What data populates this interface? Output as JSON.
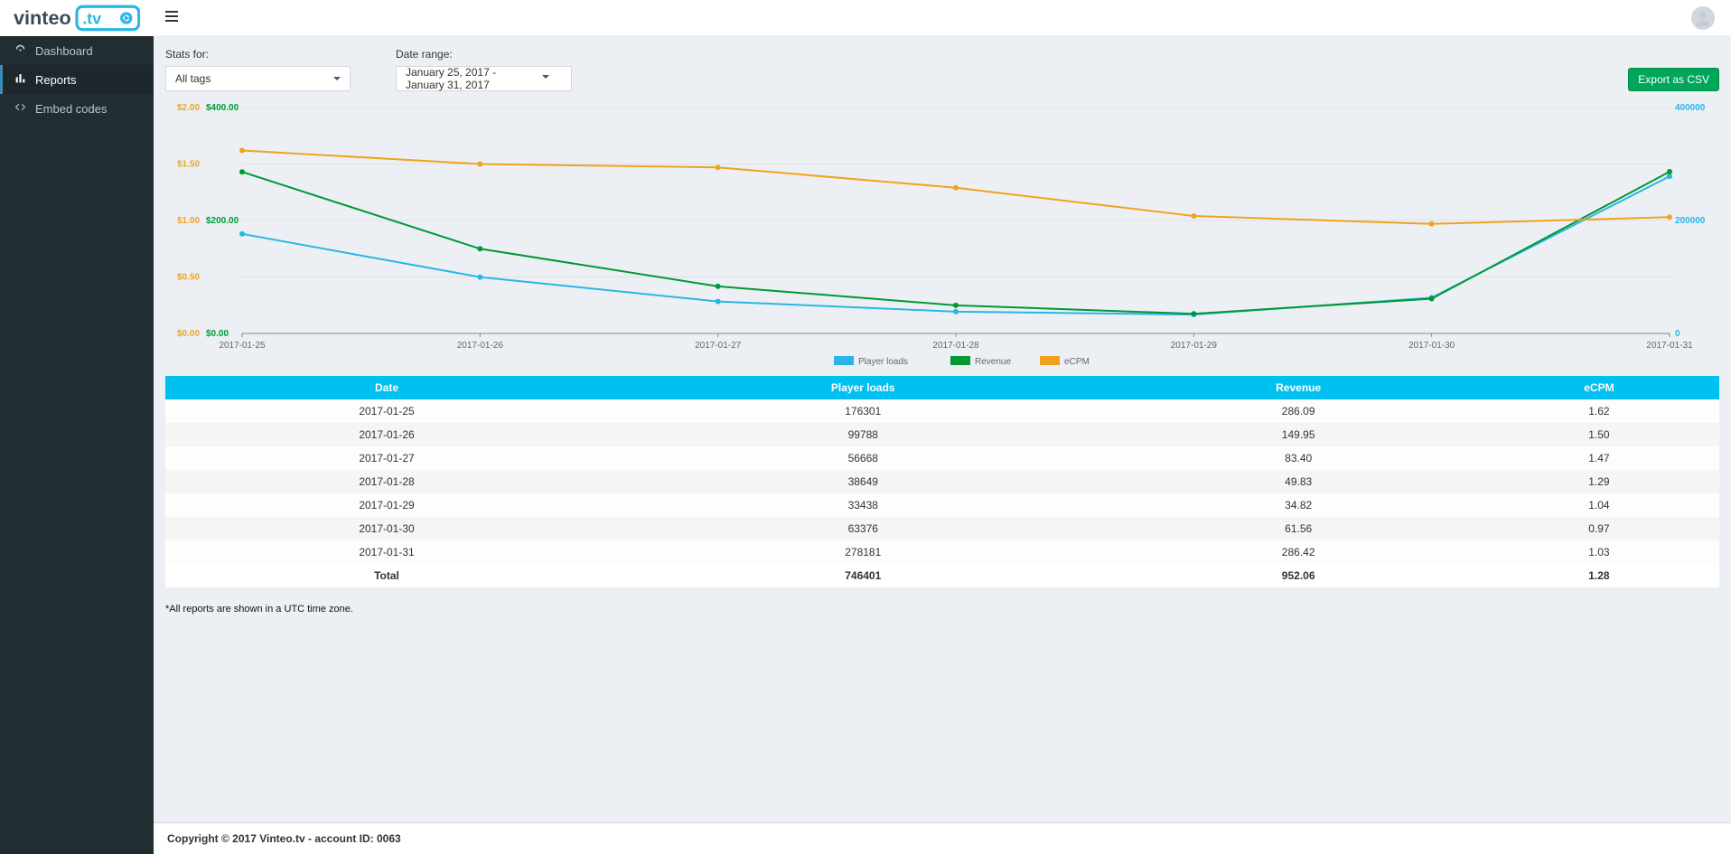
{
  "brand": {
    "name_part1": "vinteo",
    "name_part2": ".tv"
  },
  "sidebar": {
    "items": [
      {
        "label": "Dashboard",
        "icon": "dashboard-icon"
      },
      {
        "label": "Reports",
        "icon": "chart-icon",
        "active": true
      },
      {
        "label": "Embed codes",
        "icon": "code-icon"
      }
    ]
  },
  "filters": {
    "stats_for_label": "Stats for:",
    "stats_for_value": "All tags",
    "date_range_label": "Date range:",
    "date_range_value": "January 25, 2017 - January 31, 2017",
    "export_label": "Export as CSV"
  },
  "colors": {
    "player_loads": "#29b6e6",
    "revenue": "#009933",
    "ecpm": "#f0a31e",
    "header": "#00c0ef"
  },
  "table": {
    "columns": [
      "Date",
      "Player loads",
      "Revenue",
      "eCPM"
    ],
    "rows": [
      {
        "date": "2017-01-25",
        "player_loads": "176301",
        "revenue": "286.09",
        "ecpm": "1.62"
      },
      {
        "date": "2017-01-26",
        "player_loads": "99788",
        "revenue": "149.95",
        "ecpm": "1.50"
      },
      {
        "date": "2017-01-27",
        "player_loads": "56668",
        "revenue": "83.40",
        "ecpm": "1.47"
      },
      {
        "date": "2017-01-28",
        "player_loads": "38649",
        "revenue": "49.83",
        "ecpm": "1.29"
      },
      {
        "date": "2017-01-29",
        "player_loads": "33438",
        "revenue": "34.82",
        "ecpm": "1.04"
      },
      {
        "date": "2017-01-30",
        "player_loads": "63376",
        "revenue": "61.56",
        "ecpm": "0.97"
      },
      {
        "date": "2017-01-31",
        "player_loads": "278181",
        "revenue": "286.42",
        "ecpm": "1.03"
      }
    ],
    "total": {
      "label": "Total",
      "player_loads": "746401",
      "revenue": "952.06",
      "ecpm": "1.28"
    }
  },
  "tz_note": "*All reports are shown in a UTC time zone.",
  "footer": {
    "text": "Copyright © 2017 Vinteo.tv - account ID: 0063"
  },
  "chart_data": {
    "type": "line",
    "categories": [
      "2017-01-25",
      "2017-01-26",
      "2017-01-27",
      "2017-01-28",
      "2017-01-29",
      "2017-01-30",
      "2017-01-31"
    ],
    "series": [
      {
        "name": "Player loads",
        "axis": "right",
        "values": [
          176301,
          99788,
          56668,
          38649,
          33438,
          63376,
          278181
        ]
      },
      {
        "name": "Revenue",
        "axis": "left2",
        "values": [
          286.09,
          149.95,
          83.4,
          49.83,
          34.82,
          61.56,
          286.42
        ]
      },
      {
        "name": "eCPM",
        "axis": "left1",
        "values": [
          1.62,
          1.5,
          1.47,
          1.29,
          1.04,
          0.97,
          1.03
        ]
      }
    ],
    "axes": {
      "left1": {
        "label": "eCPM",
        "min": 0,
        "max": 2,
        "ticks": [
          "$0.00",
          "$0.50",
          "$1.00",
          "$1.50",
          "$2.00"
        ],
        "color": "#f0a31e"
      },
      "left2": {
        "label": "Revenue",
        "min": 0,
        "max": 400,
        "ticks": [
          "$0.00",
          "$200.00",
          "$400.00"
        ],
        "color": "#009933"
      },
      "right": {
        "label": "Player loads",
        "min": 0,
        "max": 400000,
        "ticks": [
          "0",
          "200000",
          "400000"
        ],
        "color": "#29b6e6"
      }
    },
    "legend": [
      "Player loads",
      "Revenue",
      "eCPM"
    ]
  }
}
